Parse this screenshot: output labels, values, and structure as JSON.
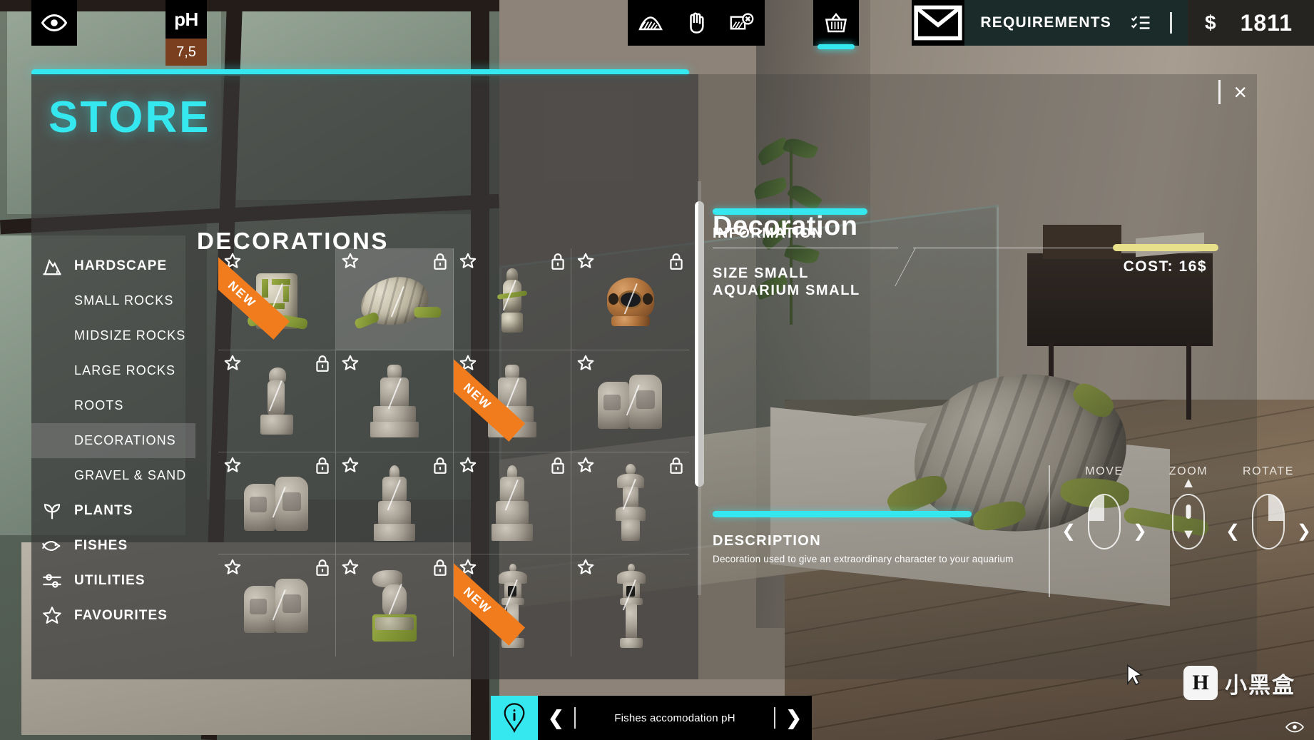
{
  "topbar": {
    "tools": [
      {
        "name": "visibility-toggle",
        "icon": "eye-icon",
        "active": false
      },
      {
        "name": "terrain-sand",
        "icon": "sand-dune-icon",
        "active": false
      },
      {
        "name": "hand-grab",
        "icon": "hand-icon",
        "active": false
      },
      {
        "name": "remove-sand",
        "icon": "sand-remove-icon",
        "active": false
      },
      {
        "name": "store-basket",
        "icon": "basket-icon",
        "active": true
      }
    ],
    "ph": {
      "label": "pH",
      "value": "7,5"
    },
    "mail_icon": "envelope-icon",
    "requirements_label": "REQUIREMENTS",
    "requirements_icon": "checklist-icon",
    "currency_symbol": "$",
    "money": "1811"
  },
  "store": {
    "title": "STORE",
    "close_label": "×",
    "category_title": "DECORATIONS",
    "sidebar": [
      {
        "label": "HARDSCAPE",
        "icon": "rock-icon",
        "level": "main",
        "selected": false
      },
      {
        "label": "SMALL ROCKS",
        "icon": "",
        "level": "sub",
        "selected": false
      },
      {
        "label": "MIDSIZE ROCKS",
        "icon": "",
        "level": "sub",
        "selected": false
      },
      {
        "label": "LARGE ROCKS",
        "icon": "",
        "level": "sub",
        "selected": false
      },
      {
        "label": "ROOTS",
        "icon": "",
        "level": "sub",
        "selected": false
      },
      {
        "label": "DECORATIONS",
        "icon": "",
        "level": "sub",
        "selected": true
      },
      {
        "label": "GRAVEL & SAND",
        "icon": "",
        "level": "sub",
        "selected": false
      },
      {
        "label": "PLANTS",
        "icon": "plant-icon",
        "level": "main",
        "selected": false
      },
      {
        "label": "FISHES",
        "icon": "fish-icon",
        "level": "main",
        "selected": false
      },
      {
        "label": "UTILITIES",
        "icon": "sliders-icon",
        "level": "main",
        "selected": false
      },
      {
        "label": "FAVOURITES",
        "icon": "star-icon",
        "level": "main",
        "selected": false
      }
    ],
    "grid": {
      "badge_new": "NEW",
      "items": [
        {
          "name": "aztec-totem",
          "favourite": false,
          "locked": false,
          "new": true,
          "selected": false,
          "kind": "block",
          "color": "moss"
        },
        {
          "name": "mossy-shell",
          "favourite": false,
          "locked": true,
          "new": false,
          "selected": true,
          "kind": "shell",
          "color": "moss"
        },
        {
          "name": "green-statue",
          "favourite": false,
          "locked": true,
          "new": false,
          "selected": false,
          "kind": "statue",
          "color": "moss"
        },
        {
          "name": "diving-helmet",
          "favourite": false,
          "locked": true,
          "new": false,
          "selected": false,
          "kind": "helmet",
          "color": "bronze"
        },
        {
          "name": "serpent-pillar",
          "favourite": false,
          "locked": true,
          "new": false,
          "selected": false,
          "kind": "pillar",
          "color": "grey"
        },
        {
          "name": "temple-idol",
          "favourite": false,
          "locked": false,
          "new": false,
          "selected": false,
          "kind": "idol",
          "color": "grey"
        },
        {
          "name": "seated-figure",
          "favourite": false,
          "locked": false,
          "new": true,
          "selected": false,
          "kind": "idol",
          "color": "grey"
        },
        {
          "name": "carved-ruins",
          "favourite": false,
          "locked": false,
          "new": false,
          "selected": false,
          "kind": "ruins",
          "color": "grey"
        },
        {
          "name": "broken-temple",
          "favourite": false,
          "locked": true,
          "new": false,
          "selected": false,
          "kind": "ruins",
          "color": "grey"
        },
        {
          "name": "stone-obelisk",
          "favourite": false,
          "locked": true,
          "new": false,
          "selected": false,
          "kind": "obelisk",
          "color": "grey"
        },
        {
          "name": "tall-monument",
          "favourite": false,
          "locked": true,
          "new": false,
          "selected": false,
          "kind": "obelisk",
          "color": "grey"
        },
        {
          "name": "pagoda-tower",
          "favourite": false,
          "locked": true,
          "new": false,
          "selected": false,
          "kind": "tower",
          "color": "grey"
        },
        {
          "name": "ruined-shrine",
          "favourite": false,
          "locked": true,
          "new": false,
          "selected": false,
          "kind": "ruins",
          "color": "grey"
        },
        {
          "name": "foo-dog-statue",
          "favourite": false,
          "locked": true,
          "new": false,
          "selected": false,
          "kind": "animal",
          "color": "grey"
        },
        {
          "name": "stone-lantern",
          "favourite": false,
          "locked": false,
          "new": true,
          "selected": false,
          "kind": "lantern",
          "color": "grey"
        },
        {
          "name": "tall-lantern",
          "favourite": false,
          "locked": false,
          "new": false,
          "selected": false,
          "kind": "lantern",
          "color": "grey"
        }
      ]
    },
    "detail": {
      "title": "Decoration",
      "cost_label": "COST: 16$",
      "information_header": "INFORMATION",
      "size_line": "SIZE SMALL",
      "aquarium_line": "AQUARIUM SMALL",
      "description_header": "DESCRIPTION",
      "description_text": "Decoration used to give an extraordinary character to your aquarium"
    }
  },
  "hints": {
    "move": "MOVE",
    "zoom": "ZOOM",
    "rotate": "ROTATE"
  },
  "tipbar": {
    "info_icon": "info-pin-icon",
    "prev": "❮",
    "next": "❯",
    "text": "Fishes accomodation pH"
  },
  "watermark": {
    "mark": "H",
    "text": "小黑盒"
  },
  "colors": {
    "accent_cyan": "#35e8ef",
    "cost_yellow": "#e8e08a",
    "new_orange": "#f07c1e",
    "panel_grey": "#383838",
    "requirements_dark": "#1b2b29"
  }
}
